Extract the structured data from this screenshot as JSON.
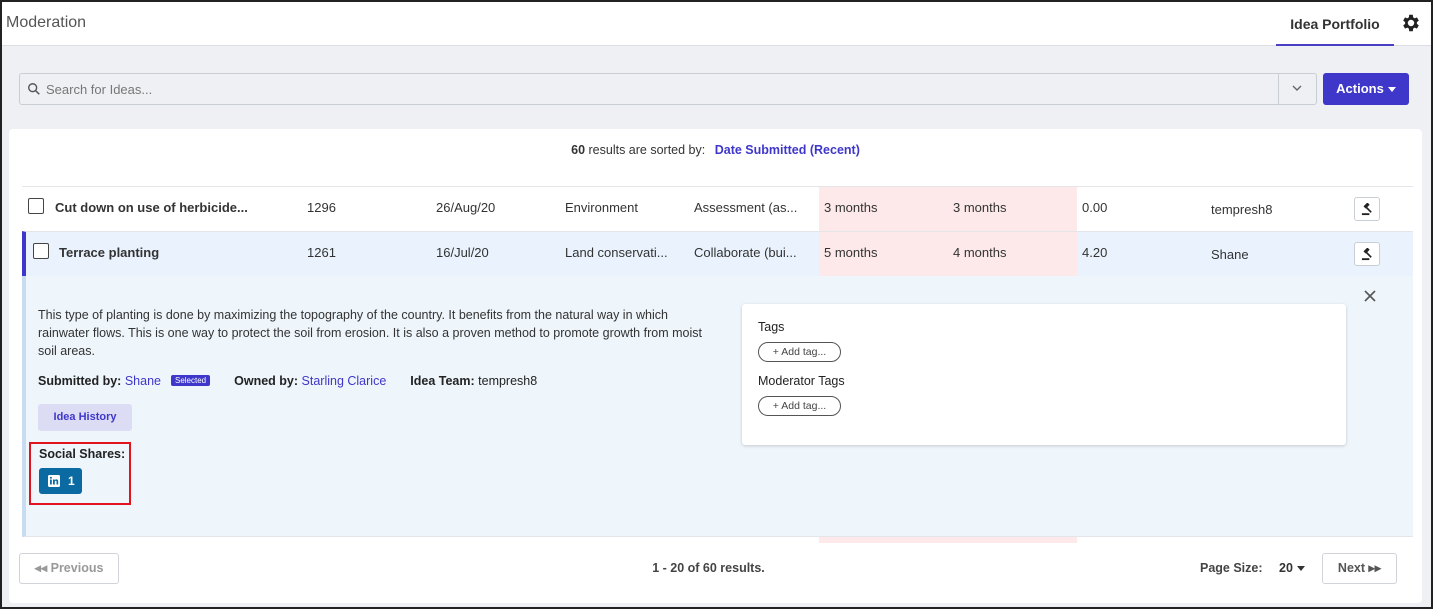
{
  "header": {
    "title": "Moderation",
    "tab_label": "Idea Portfolio",
    "settings_icon": "gear-icon"
  },
  "search": {
    "placeholder": "Search for Ideas...",
    "value": "",
    "actions_label": "Actions"
  },
  "results": {
    "count": "60",
    "sorted_text": "results are sorted by:",
    "sort_value": "Date Submitted (Recent)"
  },
  "rows": [
    {
      "title": "Cut down on use of herbicide...",
      "id": "1296",
      "date": "26/Aug/20",
      "category": "Environment",
      "stage": "Assessment (as...",
      "time_a": "3 months",
      "time_b": "3 months",
      "score": "0.00",
      "user": "tempresh8"
    },
    {
      "title": "Terrace planting",
      "id": "1261",
      "date": "16/Jul/20",
      "category": "Land conservati...",
      "stage": "Collaborate (bui...",
      "time_a": "5 months",
      "time_b": "4 months",
      "score": "4.20",
      "user": "Shane"
    }
  ],
  "detail": {
    "description": "This type of planting is done by maximizing the topography of the country. It benefits from the natural way in which rainwater flows. This is one way to protect the soil from erosion. It is also a proven method to promote growth from moist soil areas.",
    "submitted_label": "Submitted by:",
    "submitted_by": "Shane",
    "selected_badge": "Selected",
    "owned_label": "Owned by:",
    "owned_by": "Starling Clarice",
    "team_label": "Idea Team:",
    "team": "tempresh8",
    "history_label": "Idea History",
    "social_label": "Social Shares:",
    "linkedin_count": "1",
    "tags_label": "Tags",
    "add_tag_label": "+ Add tag...",
    "moderator_tags_label": "Moderator Tags",
    "moderator_add_tag_label": "+ Add tag..."
  },
  "footer": {
    "previous_label": "Previous",
    "count_text": "1 - 20 of 60 results.",
    "page_size_label": "Page Size:",
    "page_size_value": "20",
    "next_label": "Next"
  },
  "colors": {
    "accent": "#3f37c9",
    "linkedin": "#0a6aa1",
    "highlight_pink": "#fde9e9",
    "selected_row": "#eaf3fd",
    "highlight_border": "#e0141c"
  }
}
